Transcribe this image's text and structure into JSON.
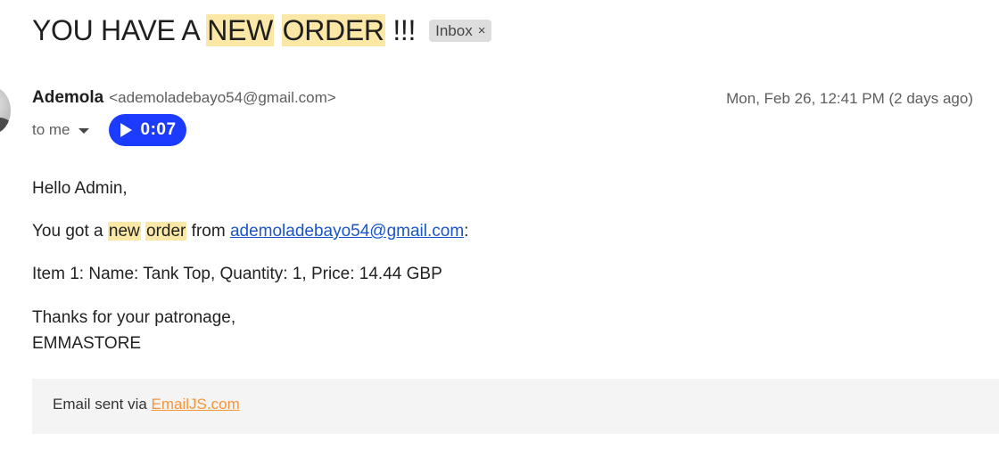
{
  "subject": {
    "part1": "YOU HAVE A ",
    "highlight1": "NEW",
    "space": " ",
    "highlight2": "ORDER",
    "part2": " !!!",
    "label_chip": "Inbox",
    "chip_close": "×"
  },
  "sender": {
    "name": "Ademola",
    "email": "<ademoladebayo54@gmail.com>",
    "date": "Mon, Feb 26, 12:41 PM (2 days ago)",
    "to": "to me"
  },
  "audio": {
    "duration": "0:07"
  },
  "body": {
    "greeting": "Hello Admin,",
    "got_prefix": "You got a ",
    "got_hl1": "new",
    "got_space": " ",
    "got_hl2": "order",
    "got_from": " from ",
    "got_email": "ademoladebayo54@gmail.com",
    "got_colon": ":",
    "item_line": "Item 1: Name: Tank Top, Quantity: 1, Price: 14.44 GBP",
    "thanks": "Thanks for your patronage,",
    "signature": "EMMASTORE"
  },
  "footer": {
    "prefix": "Email sent via ",
    "link": "EmailJS.com"
  },
  "colors": {
    "highlight": "#fce8a6",
    "play_button": "#1b3bff",
    "link": "#1a55c9",
    "footer_link": "#f5953a"
  },
  "icons": {
    "avatar": "sender-avatar",
    "caret": "chevron-down-icon",
    "play": "play-icon",
    "chip_close": "close-icon"
  }
}
